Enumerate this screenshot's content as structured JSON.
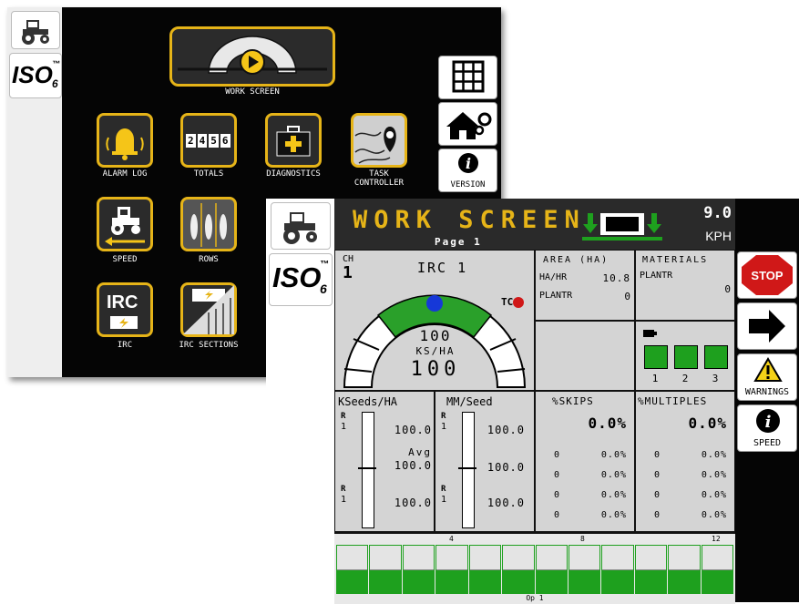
{
  "back_screen": {
    "sidebar": {
      "iso_logo": "ISO",
      "iso_logo_sub": "6",
      "iso_logo_tm": "™"
    },
    "work_screen_label": "WORK SCREEN",
    "icons": [
      {
        "label": "ALARM LOG"
      },
      {
        "label": "TOTALS"
      },
      {
        "label": "DIAGNOSTICS"
      },
      {
        "label": "TASK CONTROLLER"
      },
      {
        "label": "SPEED"
      },
      {
        "label": "ROWS"
      },
      {
        "label": "IRC"
      },
      {
        "label": "IRC SECTIONS"
      }
    ],
    "totals_digits": [
      "2",
      "4",
      "5",
      "6"
    ],
    "irc_icon_text": "IRC",
    "right_buttons": {
      "version_label": "VERSION"
    }
  },
  "front_screen": {
    "sidebar": {
      "iso_logo": "ISO",
      "iso_logo_sub": "6",
      "iso_logo_tm": "™"
    },
    "header": {
      "title": "WORK SCREEN",
      "page": "Page 1",
      "speed_value": "9.0",
      "speed_unit": "KPH"
    },
    "gauge_panel": {
      "ch_label": "CH",
      "ch_value": "1",
      "irc_label": "IRC 1",
      "tc_label": "TC",
      "target_value": "100",
      "unit": "KS/HA",
      "actual_value": "100"
    },
    "area_panel": {
      "title": "AREA (HA)",
      "rows": [
        {
          "label": "HA/HR",
          "value": "10.8"
        },
        {
          "label": "PLANTR",
          "value": "0"
        }
      ]
    },
    "materials_panel": {
      "title": "MATERIALS",
      "rows": [
        {
          "label": "PLANTR",
          "value": "0"
        }
      ]
    },
    "sections": {
      "labels": [
        "1",
        "2",
        "3"
      ]
    },
    "kseeds_panel": {
      "title": "KSeeds/HA",
      "top_row": {
        "r": "R",
        "n": "1",
        "value": "100.0"
      },
      "avg_label": "Avg",
      "avg_value": "100.0",
      "bottom_row": {
        "r": "R",
        "n": "1",
        "value": "100.0"
      }
    },
    "mm_panel": {
      "title": "MM/Seed",
      "top_row": {
        "r": "R",
        "n": "1",
        "value": "100.0"
      },
      "mid_value": "100.0",
      "bottom_row": {
        "r": "R",
        "n": "1",
        "value": "100.0"
      }
    },
    "skips_panel": {
      "title": "%SKIPS",
      "big": "0.0%",
      "rows": [
        {
          "n": "0",
          "v": "0.0%"
        },
        {
          "n": "0",
          "v": "0.0%"
        },
        {
          "n": "0",
          "v": "0.0%"
        },
        {
          "n": "0",
          "v": "0.0%"
        }
      ]
    },
    "multiples_panel": {
      "title": "%MULTIPLES",
      "big": "0.0%",
      "rows": [
        {
          "n": "0",
          "v": "0.0%"
        },
        {
          "n": "0",
          "v": "0.0%"
        },
        {
          "n": "0",
          "v": "0.0%"
        },
        {
          "n": "0",
          "v": "0.0%"
        }
      ]
    },
    "row_bar": {
      "ticks": [
        "4",
        "8",
        "12"
      ],
      "footer": "Op 1"
    },
    "right_buttons": {
      "stop_label": "STOP",
      "warnings_label": "WARNINGS",
      "speed_label": "SPEED"
    },
    "colors": {
      "accent_green": "#1ea01e",
      "header_text": "#e6b418",
      "stop_red": "#d01818",
      "blue_needle": "#1638d8"
    }
  }
}
